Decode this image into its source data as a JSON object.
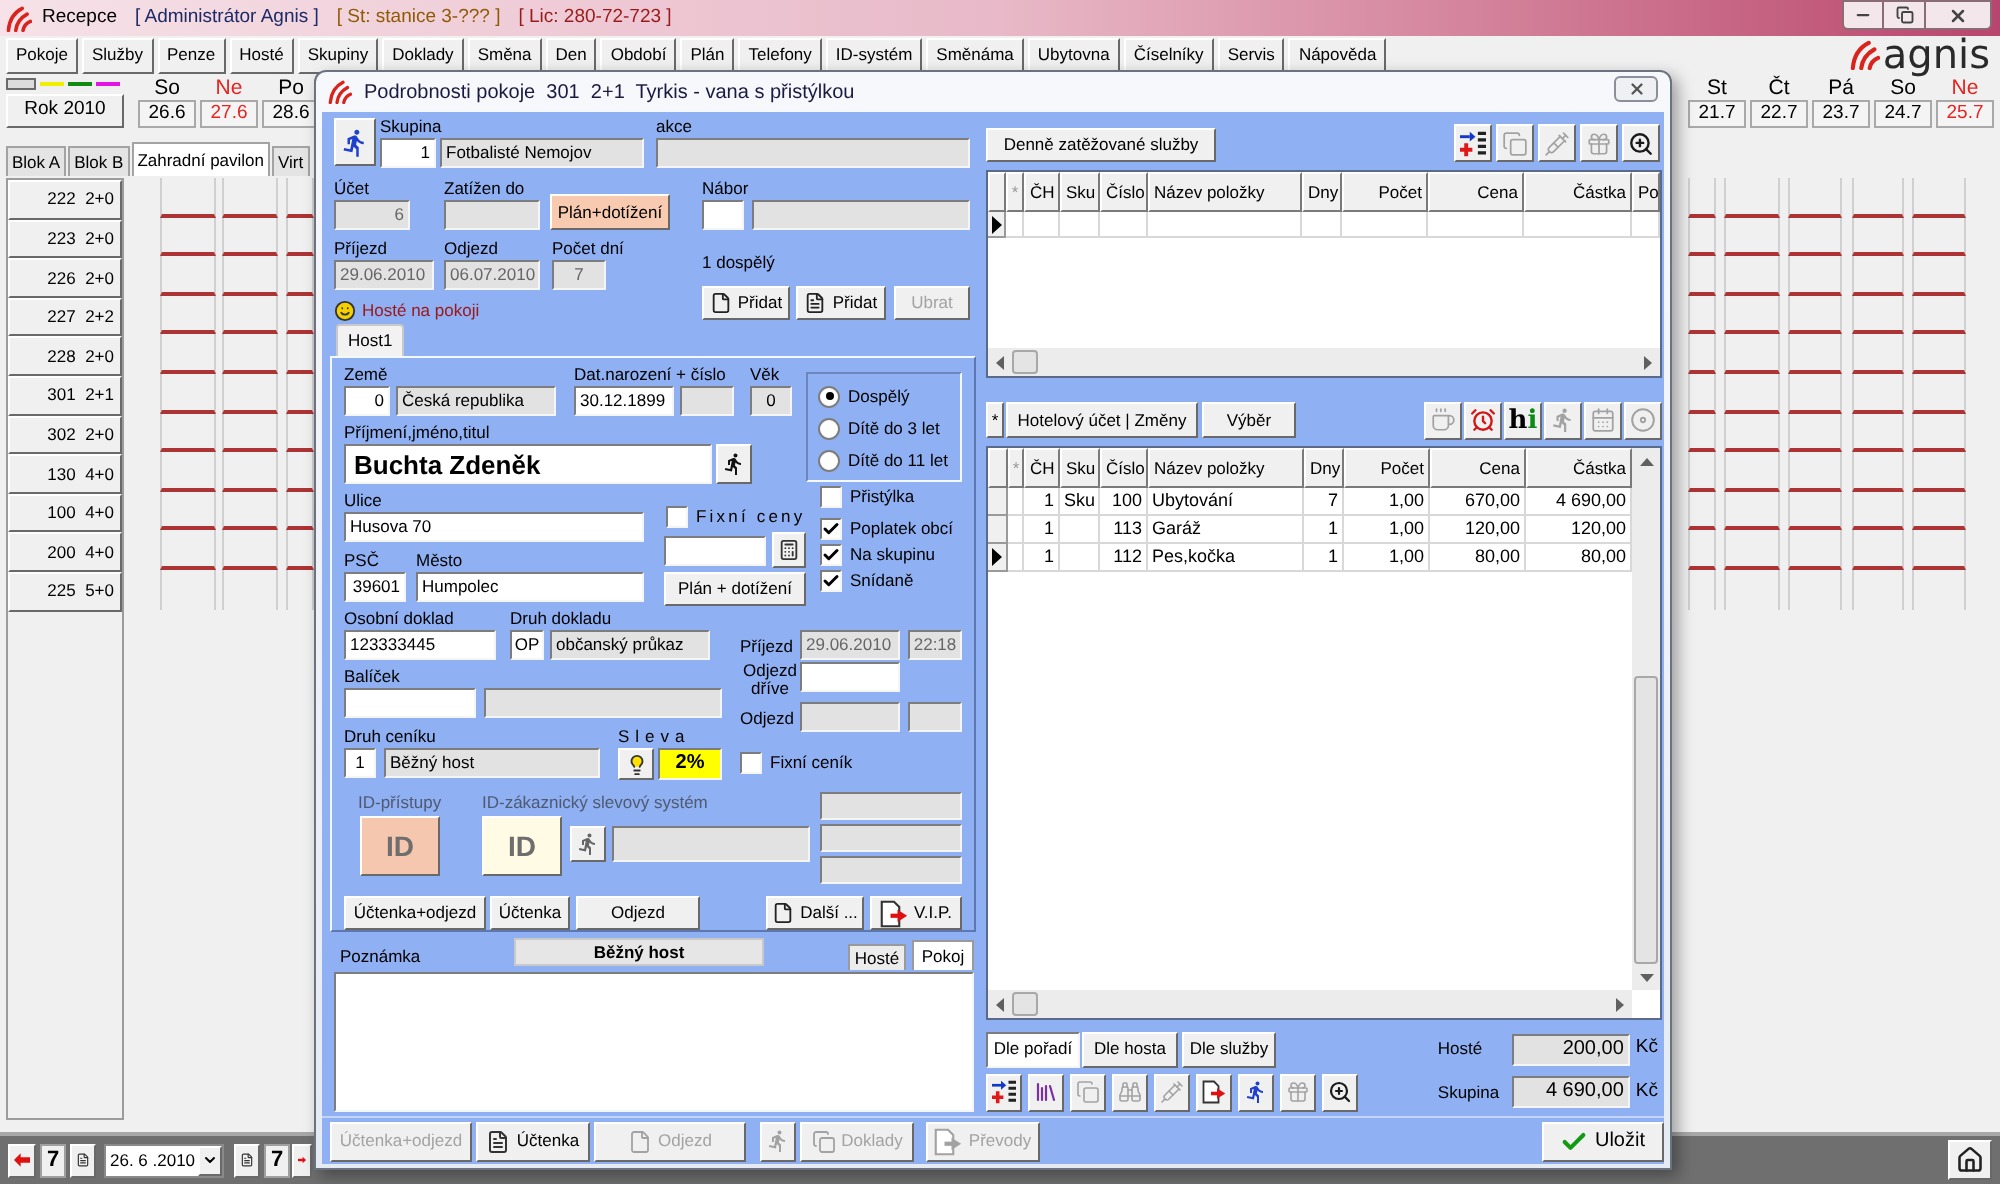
{
  "window": {
    "title": "Recepce",
    "user": "[ Administrátor Agnis ]",
    "station": "[ St: stanice 3-??? ]",
    "license": "[ Lic: 280-72-723 ]"
  },
  "menu": [
    {
      "label": "Pokoje"
    },
    {
      "label": "Služby"
    },
    {
      "label": "Penze"
    },
    {
      "label": "Hosté"
    },
    {
      "label": "Skupiny"
    },
    {
      "label": "Doklady"
    },
    {
      "label": "Směna"
    },
    {
      "label": "Den"
    },
    {
      "label": "Období"
    },
    {
      "label": "Plán"
    },
    {
      "label": "Telefony"
    },
    {
      "label": "ID-systém"
    },
    {
      "label": "Směnáma"
    },
    {
      "label": "Ubytovna"
    },
    {
      "label": "Číselníky"
    },
    {
      "label": "Servis"
    },
    {
      "label": "Nápověda"
    }
  ],
  "logo": "agnis",
  "calendar": {
    "year": "Rok 2010",
    "days_left": [
      {
        "day": "So",
        "date": "26.6",
        "sunday": false
      },
      {
        "day": "Ne",
        "date": "27.6",
        "sunday": true
      },
      {
        "day": "Po",
        "date": "28.6",
        "sunday": false
      }
    ],
    "days_right": [
      {
        "day": "St",
        "date": "21.7",
        "sunday": false
      },
      {
        "day": "Čt",
        "date": "22.7",
        "sunday": false
      },
      {
        "day": "Pá",
        "date": "23.7",
        "sunday": false
      },
      {
        "day": "So",
        "date": "24.7",
        "sunday": false
      },
      {
        "day": "Ne",
        "date": "25.7",
        "sunday": true
      }
    ]
  },
  "blocks": [
    {
      "label": "Blok A",
      "selected": false
    },
    {
      "label": "Blok B",
      "selected": false
    },
    {
      "label": "Zahradní pavilon",
      "selected": true
    },
    {
      "label": "Virt",
      "selected": false
    }
  ],
  "rooms": [
    {
      "number": "222",
      "beds": "2+0"
    },
    {
      "number": "223",
      "beds": "2+0"
    },
    {
      "number": "226",
      "beds": "2+0"
    },
    {
      "number": "227",
      "beds": "2+2"
    },
    {
      "number": "228",
      "beds": "2+0"
    },
    {
      "number": "301",
      "beds": "2+1"
    },
    {
      "number": "302",
      "beds": "2+0"
    },
    {
      "number": "130",
      "beds": "4+0"
    },
    {
      "number": "100",
      "beds": "4+0"
    },
    {
      "number": "200",
      "beds": "4+0"
    },
    {
      "number": "225",
      "beds": "5+0"
    }
  ],
  "status_bar": {
    "days_back": "7",
    "date": "26. 6 .2010",
    "days_forward": "7"
  },
  "dialog": {
    "title": "Podrobnosti pokoje  301  2+1  Tyrkis - vana s přistýlkou",
    "group": {
      "label": "Skupina",
      "number": {
        "value": "1"
      },
      "name": {
        "value": "Fotbalisté Nemojov",
        "readonly": true
      }
    },
    "action": {
      "label": "akce"
    },
    "account": {
      "label": "Účet",
      "value": "6",
      "disabled": true
    },
    "charged_until": {
      "label": "Zatížen do",
      "readonly": true
    },
    "plan_button": "Plán+dotížení",
    "recruitment": {
      "label": "Nábor"
    },
    "arrival": {
      "label": "Příjezd",
      "value": "29.06.2010",
      "disabled": true
    },
    "departure": {
      "label": "Odjezd",
      "value": "06.07.2010",
      "disabled": true
    },
    "nights": {
      "label": "Počet dní",
      "value": "7",
      "disabled": true
    },
    "occupancy": "1 dospělý",
    "guest_buttons": [
      {
        "label": "Přidat",
        "disabled": false
      },
      {
        "label": "Přidat",
        "disabled": false
      },
      {
        "label": "Ubrat",
        "disabled": true
      }
    ],
    "guests_heading": "Hosté na pokoji",
    "guest_tabs": [
      {
        "label": "Host1",
        "selected": true
      }
    ],
    "guest": {
      "country": {
        "label": "Země",
        "code": {
          "value": "0"
        },
        "name": {
          "value": "Česká republika",
          "readonly": true
        }
      },
      "birth": {
        "label": "Dat.narození + číslo",
        "date": {
          "value": "30.12.1899"
        },
        "number": {
          "readonly": true
        }
      },
      "age": {
        "label": "Věk",
        "value": "0",
        "readonly": true
      },
      "category": [
        {
          "label": "Dospělý",
          "selected": true
        },
        {
          "label": "Dítě do 3 let",
          "selected": false
        },
        {
          "label": "Dítě do 11 let",
          "selected": false
        }
      ],
      "name": {
        "label": "Příjmení,jméno,titul",
        "value": "Buchta Zdeněk"
      },
      "street": {
        "label": "Ulice",
        "value": "Husova 70"
      },
      "zip": {
        "label": "PSČ",
        "value": "39601"
      },
      "city": {
        "label": "Město",
        "value": "Humpolec"
      },
      "fixed_prices": {
        "label": "Fixní ceny",
        "checked": false
      },
      "plan_button": "Plán + dotížení",
      "extra_bed": {
        "label": "Přistýlka",
        "checked": false
      },
      "options": [
        {
          "label": "Poplatek obcí",
          "checked": true
        },
        {
          "label": "Na skupinu",
          "checked": true
        },
        {
          "label": "Snídaně",
          "checked": true
        }
      ],
      "id_document": {
        "label": "Osobní doklad",
        "value": "123333445"
      },
      "document_type": {
        "label": "Druh dokladu",
        "code": {
          "value": "OP"
        },
        "name": {
          "value": "občanský průkaz",
          "readonly": true
        }
      },
      "package": {
        "label": "Balíček"
      },
      "price_list": {
        "label": "Druh ceníku",
        "code": {
          "value": "1"
        },
        "name": {
          "value": "Běžný host",
          "readonly": true
        }
      },
      "discount": {
        "label": "Sleva",
        "value": "2%"
      },
      "stay_arrival": {
        "label": "Příjezd",
        "date": {
          "value": "29.06.2010",
          "disabled": true
        },
        "time": {
          "value": "22:18",
          "disabled": true
        }
      },
      "early_departure": {
        "label": "Odjezd dříve"
      },
      "stay_departure": {
        "label": "Odjezd"
      },
      "fixed_price_list": {
        "label": "Fixní ceník",
        "checked": false
      },
      "id_access": {
        "label": "ID-přístupy",
        "button": "ID",
        "disabled": true
      },
      "id_discount": {
        "label": "ID-zákaznický slevový systém",
        "button": "ID",
        "disabled": true
      },
      "actions": [
        {
          "label": "Účtenka+odjezd"
        },
        {
          "label": "Účtenka"
        },
        {
          "label": "Odjezd"
        }
      ],
      "more_button": "Další ...",
      "vip_button": "V.I.P."
    },
    "note": {
      "label": "Poznámka",
      "price_list": "Běžný host",
      "tabs": [
        {
          "label": "Hosté",
          "selected": false
        },
        {
          "label": "Pokoj",
          "selected": true
        }
      ]
    },
    "bottom_buttons": [
      {
        "label": "Účtenka+odjezd",
        "disabled": true
      },
      {
        "label": "Účtenka",
        "disabled": false
      },
      {
        "label": "Odjezd",
        "disabled": true
      },
      {
        "label": "Doklady",
        "disabled": true
      },
      {
        "label": "Převody",
        "disabled": true
      }
    ],
    "runner_button": {
      "disabled": true
    },
    "save_button": "Uložit",
    "daily_services": {
      "button": "Denně zatěžované služby",
      "tools": [
        {
          "disabled": false
        },
        {
          "disabled": true
        },
        {
          "disabled": true
        },
        {
          "disabled": true
        },
        {
          "disabled": false
        }
      ],
      "columns": [
        "*",
        "ČH",
        "Sku",
        "Číslo",
        "Název položky",
        "Dny",
        "Počet",
        "Cena",
        "Částka",
        "Po"
      ]
    },
    "bill": {
      "star": "*",
      "buttons": [
        "Hotelový účet | Změny",
        "Výběr"
      ],
      "tools": [
        {
          "disabled": true
        },
        {
          "disabled": false
        },
        {
          "text": "hi",
          "disabled": false
        },
        {
          "disabled": true
        },
        {
          "disabled": true
        },
        {
          "disabled": true
        }
      ],
      "columns": [
        "*",
        "ČH",
        "Sku",
        "Číslo",
        "Název položky",
        "Dny",
        "Počet",
        "Cena",
        "Částka"
      ],
      "rows": [
        {
          "ch": "1",
          "sku": "Sku",
          "number": "100",
          "name": "Ubytování",
          "days": "7",
          "count": "1,00",
          "price": "670,00",
          "amount": "4 690,00",
          "selected": false
        },
        {
          "ch": "1",
          "number": "113",
          "name": "Garáž",
          "days": "1",
          "count": "1,00",
          "price": "120,00",
          "amount": "120,00",
          "selected": false
        },
        {
          "ch": "1",
          "number": "112",
          "name": "Pes,kočka",
          "days": "1",
          "count": "1,00",
          "price": "80,00",
          "amount": "80,00",
          "selected": true
        }
      ]
    },
    "sort_buttons": [
      {
        "label": "Dle pořadí",
        "selected": true
      },
      {
        "label": "Dle hosta",
        "selected": false
      },
      {
        "label": "Dle služby",
        "selected": false
      }
    ],
    "totals": [
      {
        "label": "Hosté",
        "value": "200,00",
        "currency": "Kč"
      },
      {
        "label": "Skupina",
        "value": "4 690,00",
        "currency": "Kč"
      }
    ],
    "bottom_tools": [
      {
        "disabled": false
      },
      {
        "disabled": false
      },
      {
        "disabled": true
      },
      {
        "disabled": true
      },
      {
        "disabled": true
      },
      {
        "disabled": false
      },
      {
        "disabled": false
      },
      {
        "disabled": true
      },
      {
        "disabled": false
      }
    ]
  }
}
